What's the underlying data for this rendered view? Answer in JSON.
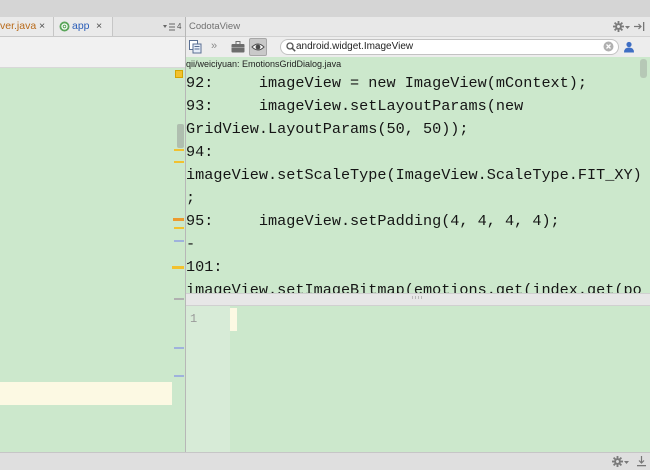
{
  "editor_tabs": {
    "tabs": [
      {
        "label": "ver.java",
        "close": "×"
      },
      {
        "label": "app",
        "close": "×",
        "icon": "android-module-icon"
      }
    ],
    "hidden_tabs": {
      "icon": "tab-list-icon",
      "count": "4"
    }
  },
  "codota": {
    "title": "CodotaView",
    "header_icons": {
      "settings": "gear-icon",
      "hide": "hide-panel-icon"
    },
    "toolbar": {
      "copy_icon": "copy-icon",
      "more_label": "»",
      "briefcase_icon": "briefcase-icon",
      "view_icon": "eye-icon",
      "search": {
        "icon": "search-icon",
        "value": "android.widget.ImageView",
        "clear_icon": "clear-icon"
      },
      "user_icon": "user-icon"
    },
    "result": {
      "path": "qii/weiciyuan: EmotionsGridDialog.java",
      "code_lines": [
        "92:     imageView = new ImageView(mContext);",
        "93:     imageView.setLayoutParams(new",
        "GridView.LayoutParams(50, 50));",
        "94:",
        "imageView.setScaleType(ImageView.ScaleType.FIT_XY)",
        ";",
        "95:     imageView.setPadding(4, 4, 4, 4);",
        "-",
        "101:",
        "imageView.setImageBitmap(emotions.get(index.get(po"
      ]
    },
    "scratch_editor": {
      "line_numbers": [
        "1"
      ]
    }
  },
  "status_bar": {
    "settings_icon": "gear-icon",
    "hide_icon": "hide-bottom-icon"
  },
  "colors": {
    "editor_bg": "#cce8cc",
    "gutter_bg": "#d7ebd7",
    "current_line": "#fcf9e3",
    "unversioned_file": "#b86a1a",
    "module_tab": "#2b5eb8",
    "user_icon": "#3f6fc4",
    "warning_mark": "#f2c12e",
    "error_mark": "#ec9a2e",
    "info_mark": "#9fb2dc"
  }
}
